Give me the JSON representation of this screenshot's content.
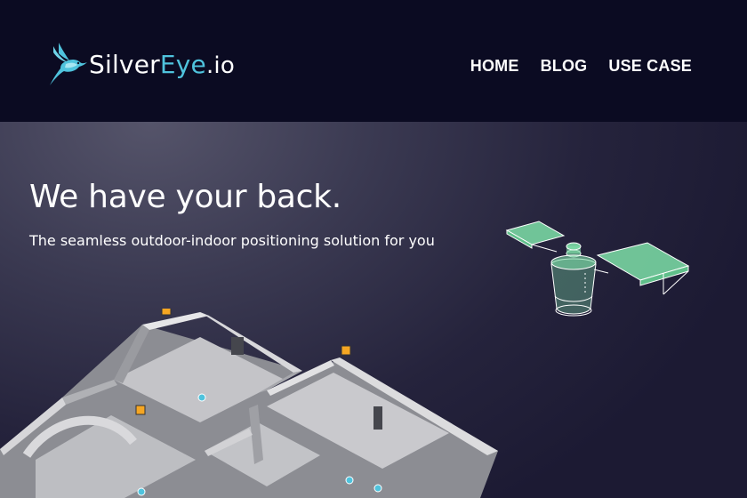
{
  "brand": {
    "name_part1": "Silver",
    "name_part2": "Eye",
    "name_part3": ".io",
    "logo_icon": "hummingbird-icon",
    "accent_color": "#4fc3dd"
  },
  "nav": {
    "items": [
      {
        "label": "HOME"
      },
      {
        "label": "BLOG"
      },
      {
        "label": "USE CASE"
      }
    ]
  },
  "hero": {
    "title": "We have your back.",
    "subtitle": "The seamless outdoor-indoor positioning solution for you",
    "illustrations": [
      "satellite-illustration",
      "floorplan-illustration"
    ],
    "marker_colors": {
      "beacon": "#f5a623",
      "device": "#4fc3dd",
      "satellite_panel": "#7ee0a8"
    }
  }
}
